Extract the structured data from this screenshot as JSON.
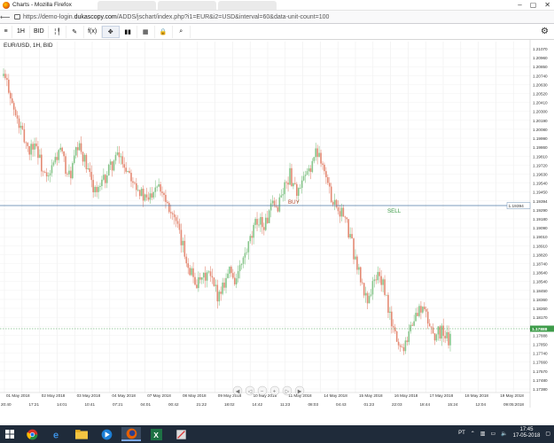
{
  "window": {
    "title": "Charts - Mozilla Firefox",
    "url_prefix": "https://demo-login.",
    "url_domain": "dukascopy.com",
    "url_rest": "/ADDS/jschart/index.php?i1=EUR&i2=USD&interval=60&data-unit-count=100"
  },
  "toolbar": {
    "items": [
      {
        "name": "menu-icon",
        "label": "≡"
      },
      {
        "name": "interval-button",
        "label": "1H"
      },
      {
        "name": "price-side-button",
        "label": "BID"
      },
      {
        "name": "chart-type-button",
        "label": "╎╿"
      },
      {
        "name": "draw-tool-button",
        "label": "✎"
      },
      {
        "name": "indicator-button",
        "label": "f(x)"
      },
      {
        "name": "crosshair-button",
        "label": "✥"
      },
      {
        "name": "volume-button",
        "label": "▮▮"
      },
      {
        "name": "calculator-button",
        "label": "▦"
      },
      {
        "name": "lock-button",
        "label": "🔒"
      },
      {
        "name": "zoom-button",
        "label": "⌕"
      }
    ]
  },
  "chart": {
    "instrument": "EUR/USD, 1H, BID",
    "buy_label": "BUY",
    "sell_label": "SELL",
    "line_price": "1.19394",
    "current_price": "1.17888",
    "colors": {
      "bull": "#86c58a",
      "bear": "#e48a74",
      "line": "#4f7aa6",
      "current": "#3e9c4a",
      "buy": "#b0462c",
      "sell": "#3a9a45"
    }
  },
  "chart_data": {
    "type": "candlestick",
    "y_tick_labels": [
      "1.21070",
      "1.20960",
      "1.20850",
      "1.20740",
      "1.20630",
      "1.20520",
      "1.20410",
      "1.20300",
      "1.20190",
      "1.20080",
      "1.19990",
      "1.19860",
      "1.19810",
      "1.19720",
      "1.19630",
      "1.19540",
      "1.19450",
      "1.19394",
      "1.19290",
      "1.19180",
      "1.19090",
      "1.19010",
      "1.18910",
      "1.18820",
      "1.18740",
      "1.18640",
      "1.18540",
      "1.18450",
      "1.18360",
      "1.18260",
      "1.18170",
      "1.18080",
      "1.17888",
      "1.17850",
      "1.17740",
      "1.17660",
      "1.17570",
      "1.17480",
      "1.17380"
    ],
    "ylim": [
      1.173,
      1.2107
    ],
    "x_date_labels": [
      "01 May 2018",
      "02 May 2018",
      "03 May 2018",
      "04 May 2018",
      "07 May 2018",
      "08 May 2018",
      "09 May 2018",
      "10 May 2018",
      "11 May 2018",
      "14 May 2018",
      "15 May 2018",
      "16 May 2018",
      "17 May 2018",
      "18 May 2018",
      "19 May 2018"
    ],
    "x_time_labels": [
      "20:40",
      "17:21",
      "14:01",
      "10:41",
      "07:21",
      "04:01",
      "00:42",
      "21:22",
      "18:02",
      "14:42",
      "11:23",
      "08:03",
      "04:43",
      "01:23",
      "22:03",
      "18:44",
      "15:24",
      "12:04",
      "09:05:2018"
    ],
    "close_path": [
      1.207,
      1.2062,
      1.2058,
      1.204,
      1.2028,
      1.202,
      1.2012,
      1.2004,
      1.1998,
      1.199,
      1.1996,
      1.2,
      1.1988,
      1.1975,
      1.1965,
      1.1958,
      1.196,
      1.1972,
      1.198,
      1.1986,
      1.199,
      1.1978,
      1.1968,
      1.1962,
      1.197,
      1.1985,
      1.1992,
      1.199,
      1.1982,
      1.197,
      1.1962,
      1.1955,
      1.1948,
      1.1946,
      1.195,
      1.1958,
      1.1964,
      1.197,
      1.1976,
      1.198,
      1.1984,
      1.1982,
      1.1976,
      1.197,
      1.1968,
      1.1962,
      1.1958,
      1.195,
      1.1944,
      1.1938,
      1.1936,
      1.194,
      1.1948,
      1.1954,
      1.1958,
      1.195,
      1.1944,
      1.1936,
      1.193,
      1.1922,
      1.1912,
      1.1902,
      1.1892,
      1.1882,
      1.1872,
      1.1864,
      1.1856,
      1.185,
      1.1846,
      1.1848,
      1.1852,
      1.1858,
      1.1854,
      1.1846,
      1.184,
      1.1834,
      1.1842,
      1.185,
      1.1856,
      1.1862,
      1.1856,
      1.185,
      1.1858,
      1.1866,
      1.1874,
      1.1882,
      1.189,
      1.19,
      1.191,
      1.1918,
      1.1914,
      1.1908,
      1.1916,
      1.1924,
      1.193,
      1.1926,
      1.1934,
      1.1942,
      1.195,
      1.1958,
      1.1964,
      1.1956,
      1.195,
      1.1944,
      1.1952,
      1.1958,
      1.1964,
      1.1972,
      1.198,
      1.1986,
      1.199,
      1.1982,
      1.197,
      1.1956,
      1.1944,
      1.1938,
      1.1934,
      1.1928,
      1.1924,
      1.1918,
      1.1908,
      1.1896,
      1.1884,
      1.1872,
      1.186,
      1.1846,
      1.1836,
      1.183,
      1.1838,
      1.1846,
      1.1852,
      1.1858,
      1.185,
      1.1838,
      1.1824,
      1.181,
      1.1798,
      1.179,
      1.1782,
      1.1776,
      1.1784,
      1.1792,
      1.18,
      1.1806,
      1.1812,
      1.1818,
      1.1822,
      1.1816,
      1.1808,
      1.18,
      1.1796,
      1.179,
      1.1794,
      1.1798,
      1.179,
      1.1786,
      1.1789
    ]
  },
  "nav_controls": [
    "◀",
    "◁",
    "−",
    "+",
    "▷",
    "▶"
  ],
  "taskbar": {
    "language": "PT",
    "time": "17:45",
    "date": "17-05-2018"
  }
}
